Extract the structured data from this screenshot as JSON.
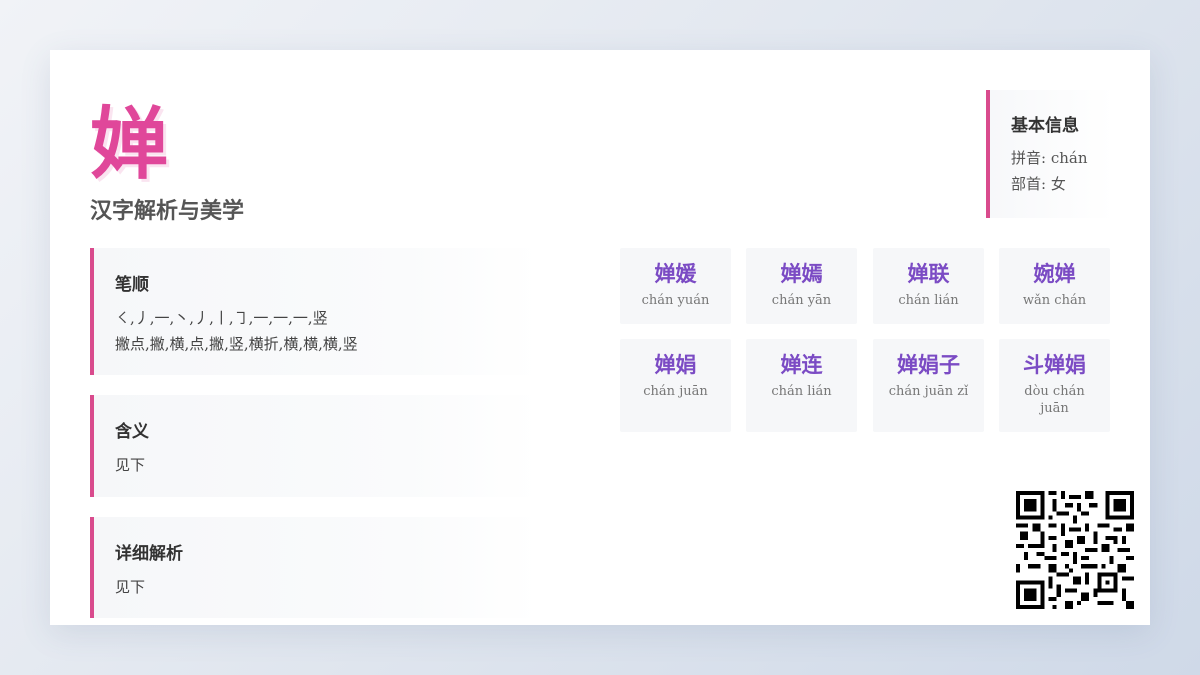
{
  "character": "婵",
  "subtitle": "汉字解析与美学",
  "basic_info": {
    "title": "基本信息",
    "pinyin": "拼音: chán",
    "radical": "部首: 女"
  },
  "sections": {
    "stroke_order": {
      "title": "笔顺",
      "symbols": "㇛,丿,一,丶,丿,丨,㇆,一,一,一,竖",
      "names": "撇点,撇,横,点,撇,竖,横折,横,横,横,竖"
    },
    "meaning": {
      "title": "含义",
      "text": "见下"
    },
    "detail": {
      "title": "详细解析",
      "text": "见下"
    }
  },
  "words": [
    {
      "hanzi": "婵媛",
      "pinyin": "chán yuán"
    },
    {
      "hanzi": "婵嫣",
      "pinyin": "chán yān"
    },
    {
      "hanzi": "婵联",
      "pinyin": "chán lián"
    },
    {
      "hanzi": "婉婵",
      "pinyin": "wǎn chán"
    },
    {
      "hanzi": "婵娟",
      "pinyin": "chán juān"
    },
    {
      "hanzi": "婵连",
      "pinyin": "chán lián"
    },
    {
      "hanzi": "婵娟子",
      "pinyin": "chán juān zǐ"
    },
    {
      "hanzi": "斗婵娟",
      "pinyin": "dòu chán juān"
    }
  ],
  "colors": {
    "accent_pink": "#e0479a",
    "border_pink": "#d94b8d",
    "word_purple": "#7b4bc4"
  },
  "icons": {
    "qr": "qr-code-icon"
  }
}
